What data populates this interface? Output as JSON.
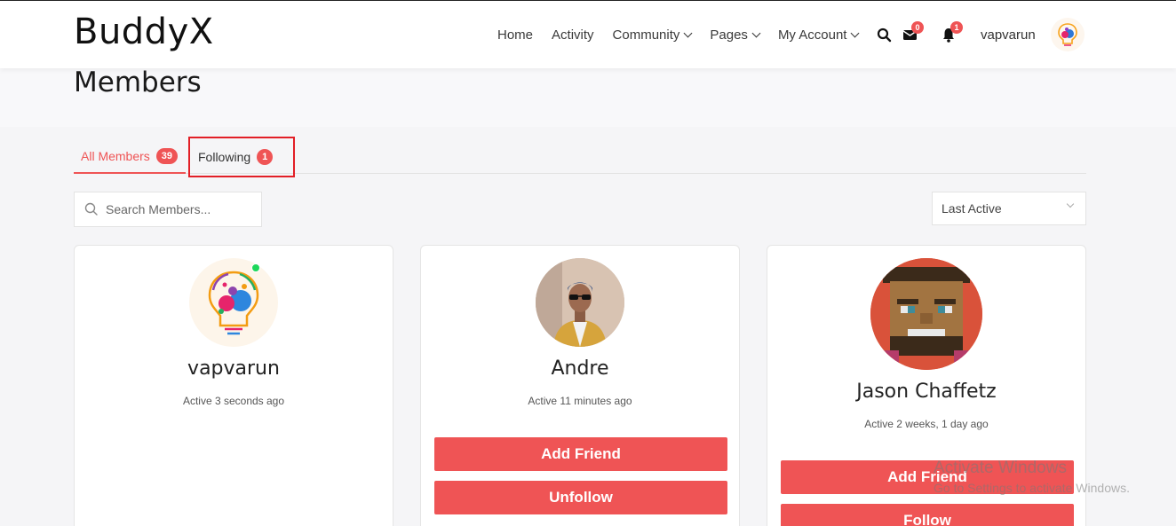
{
  "site": {
    "logo": "BuddyX"
  },
  "nav": {
    "items": [
      {
        "label": "Home",
        "has_dropdown": false
      },
      {
        "label": "Activity",
        "has_dropdown": false
      },
      {
        "label": "Community",
        "has_dropdown": true
      },
      {
        "label": "Pages",
        "has_dropdown": true
      },
      {
        "label": "My Account",
        "has_dropdown": true
      }
    ],
    "messages_count": "0",
    "notifications_count": "1",
    "username": "vapvarun"
  },
  "page": {
    "title": "Members"
  },
  "tabs": [
    {
      "label": "All Members",
      "count": "39",
      "active": true
    },
    {
      "label": "Following",
      "count": "1",
      "active": false,
      "highlighted": true
    }
  ],
  "search": {
    "placeholder": "Search Members..."
  },
  "sort": {
    "selected": "Last Active"
  },
  "members": [
    {
      "name": "vapvarun",
      "active": "Active 3 seconds ago",
      "buttons": []
    },
    {
      "name": "Andre",
      "active": "Active 11 minutes ago",
      "buttons": [
        "Add Friend",
        "Unfollow"
      ]
    },
    {
      "name": "Jason Chaffetz",
      "active": "Active 2 weeks, 1 day ago",
      "buttons": [
        "Add Friend",
        "Follow"
      ]
    }
  ],
  "watermark": {
    "line1": "Activate Windows",
    "line2": "Go to Settings to activate Windows."
  },
  "colors": {
    "accent": "#ef5455",
    "highlight_box": "#e21f26",
    "online": "#1dd75a"
  }
}
